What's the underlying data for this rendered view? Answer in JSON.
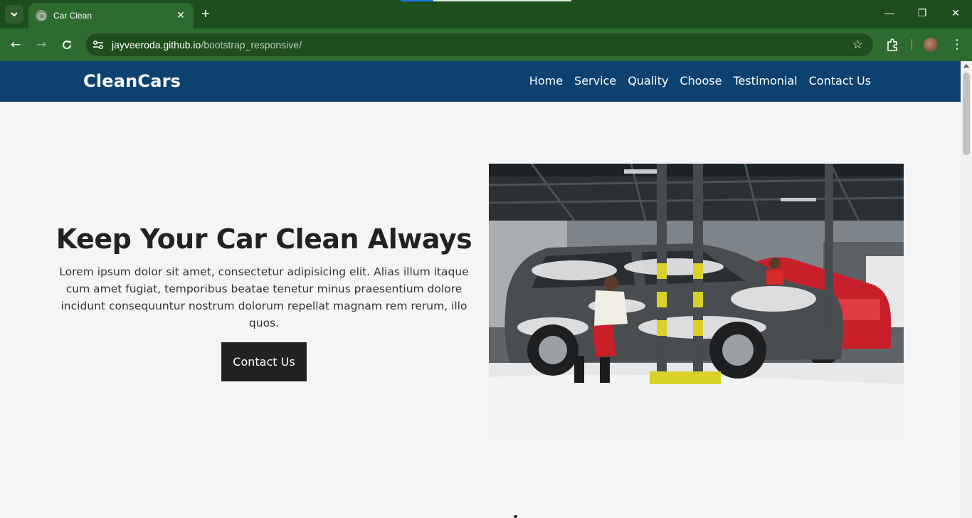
{
  "browser": {
    "tab_title": "Car Clean",
    "url_host": "jayveeroda.github.io",
    "url_path": "/bootstrap_responsive/"
  },
  "site": {
    "brand": "CleanCars",
    "nav": [
      "Home",
      "Service",
      "Quality",
      "Choose",
      "Testimonial",
      "Contact Us"
    ],
    "colors": {
      "nav_bg": "#0c4170",
      "button_bg": "#222222",
      "page_bg": "#f5f5f5"
    }
  },
  "hero": {
    "title": "Keep Your Car Clean Always",
    "text": "Lorem ipsum dolor sit amet, consectetur adipisicing elit. Alias illum itaque cum amet fugiat, temporibus beatae tenetur minus praesentium dolore incidunt consequuntur nostrum dolorum repellat magnam rem rerum, illo quos.",
    "button": "Contact Us",
    "image_alt": "car-wash-photo"
  }
}
